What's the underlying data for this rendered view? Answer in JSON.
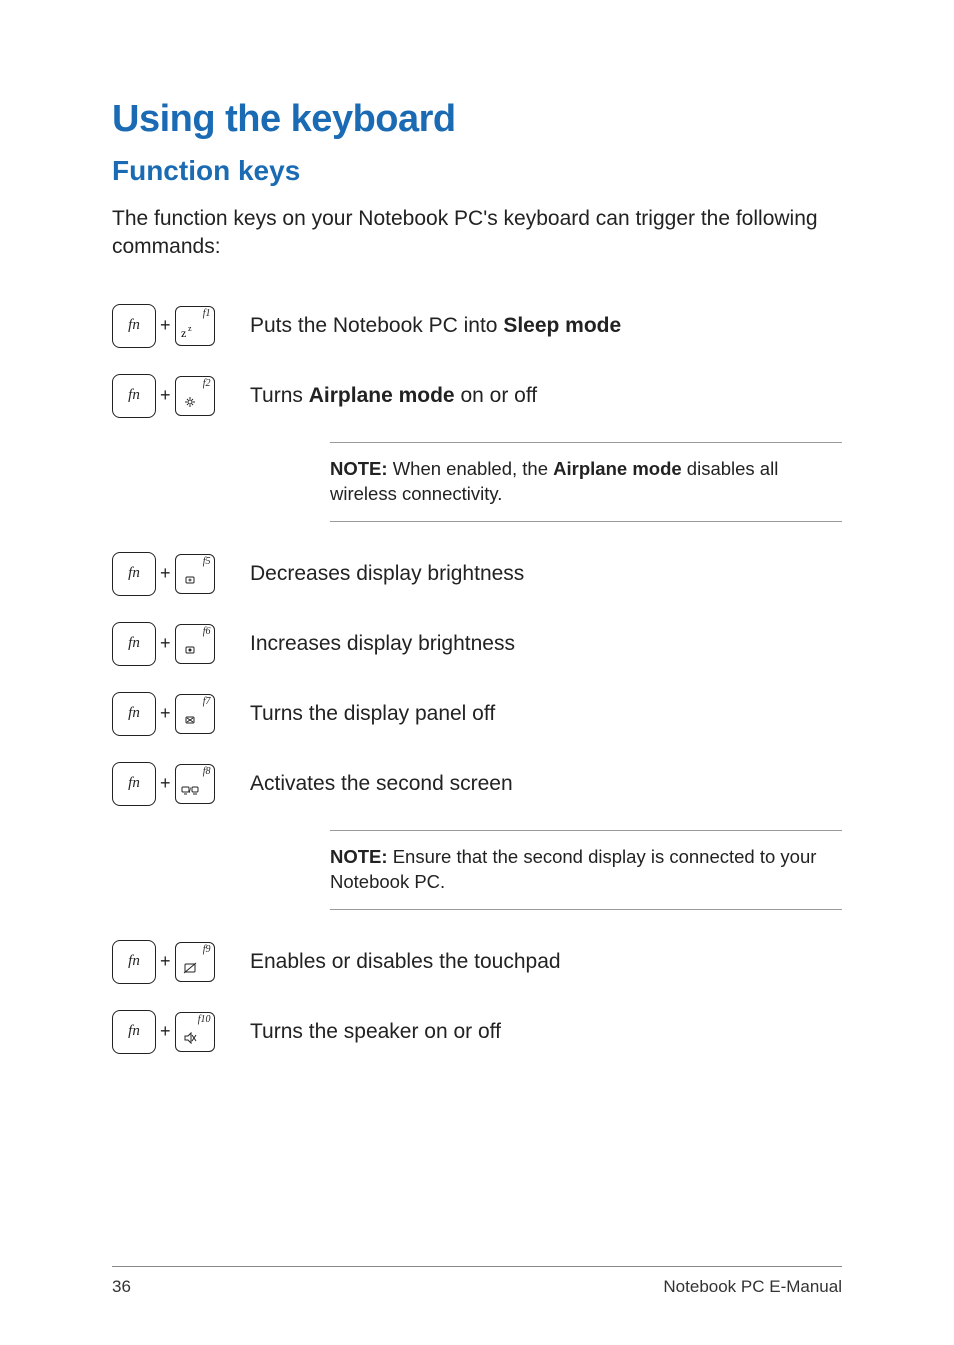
{
  "heading": "Using the keyboard",
  "subheading": "Function keys",
  "intro": "The function keys on your Notebook PC's keyboard can trigger the following commands:",
  "fn_label": "fn",
  "rows": {
    "f1": {
      "flabel": "f1",
      "desc_pre": "Puts the Notebook PC into ",
      "desc_bold": "Sleep mode",
      "desc_post": ""
    },
    "f2": {
      "flabel": "f2",
      "desc_pre": "Turns ",
      "desc_bold": "Airplane mode",
      "desc_post": " on or off"
    },
    "f5": {
      "flabel": "f5",
      "desc": "Decreases display brightness"
    },
    "f6": {
      "flabel": "f6",
      "desc": "Increases display brightness"
    },
    "f7": {
      "flabel": "f7",
      "desc": "Turns the display panel off"
    },
    "f8": {
      "flabel": "f8",
      "desc": "Activates the second screen"
    },
    "f9": {
      "flabel": "f9",
      "desc": "Enables or disables the touchpad"
    },
    "f10": {
      "flabel": "f10",
      "desc": "Turns the speaker on or off"
    }
  },
  "note1": {
    "label": "NOTE:",
    "pre": " When enabled, the ",
    "bold": "Airplane mode",
    "post": " disables all wireless connectivity."
  },
  "note2": {
    "label": "NOTE:",
    "text": " Ensure that the second display is connected to your Notebook PC."
  },
  "footer": {
    "page": "36",
    "title": "Notebook PC E-Manual"
  },
  "plus": "+"
}
